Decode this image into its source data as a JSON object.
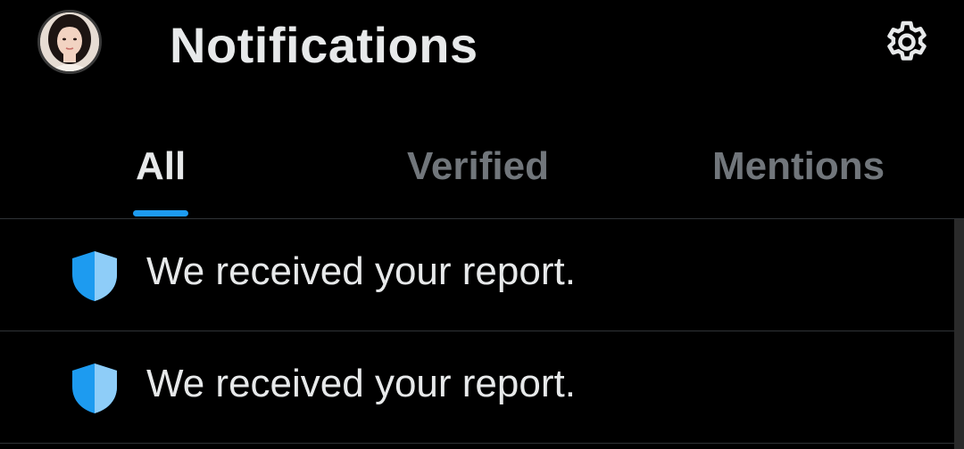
{
  "header": {
    "title": "Notifications",
    "avatar_icon": "profile-avatar",
    "settings_icon": "gear-icon"
  },
  "tabs": [
    {
      "label": "All",
      "active": true
    },
    {
      "label": "Verified",
      "active": false
    },
    {
      "label": "Mentions",
      "active": false
    }
  ],
  "notifications": [
    {
      "icon": "shield-icon",
      "text": "We received your report."
    },
    {
      "icon": "shield-icon",
      "text": "We received your report."
    }
  ],
  "colors": {
    "background": "#000000",
    "text_primary": "#e7e9ea",
    "text_secondary": "#71767b",
    "accent": "#1d9bf0",
    "divider": "#2f3336"
  }
}
